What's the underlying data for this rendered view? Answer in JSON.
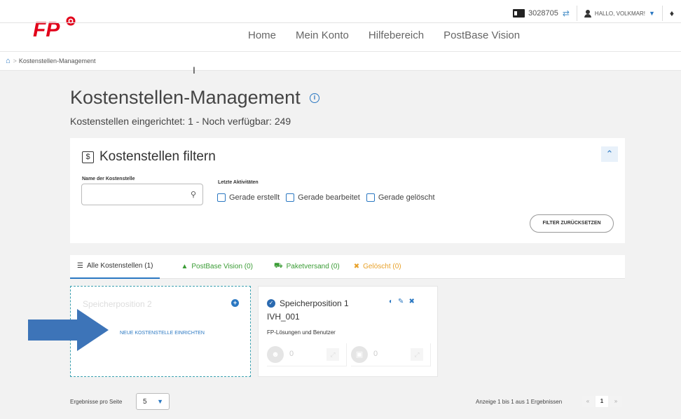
{
  "header": {
    "account_number": "3028705",
    "greeting": "HALLO, VOLKMAR!",
    "nav": [
      "Home",
      "Mein Konto",
      "Hilfebereich",
      "PostBase Vision"
    ]
  },
  "breadcrumb": {
    "current": "Kostenstellen-Management"
  },
  "page": {
    "title": "Kostenstellen-Management",
    "subtitle": "Kostenstellen eingerichtet: 1 - Noch verfügbar: 249"
  },
  "filter": {
    "title": "Kostenstellen filtern",
    "name_label": "Name der Kostenstelle",
    "name_value": "",
    "activity_label": "Letzte Aktivitäten",
    "checkboxes": [
      "Gerade erstellt",
      "Gerade bearbeitet",
      "Gerade gelöscht"
    ],
    "reset_label": "FILTER ZURÜCKSETZEN"
  },
  "tabs": [
    {
      "label": "Alle Kostenstellen (1)"
    },
    {
      "label": "PostBase Vision (0)"
    },
    {
      "label": "Paketversand (0)"
    },
    {
      "label": "Gelöscht (0)"
    }
  ],
  "new_card": {
    "title": "Speicherposition 2",
    "link": "NEUE KOSTENSTELLE EINRICHTEN"
  },
  "pos_card": {
    "title": "Speicherposition 1",
    "code": "IVH_001",
    "subtitle": "FP-Lösungen und Benutzer",
    "stat1": "0",
    "stat2": "0"
  },
  "footer": {
    "per_page_label": "Ergebnisse pro Seite",
    "per_page_value": "5",
    "range": "Anzeige 1 bis 1 aus 1 Ergebnissen",
    "prev": "«",
    "page": "1",
    "next": "»"
  },
  "colors": {
    "accent": "#2b78c2",
    "brand_red": "#e2001a",
    "green": "#3a9c35",
    "orange": "#e8a12a",
    "arrow": "#3d74b8"
  }
}
